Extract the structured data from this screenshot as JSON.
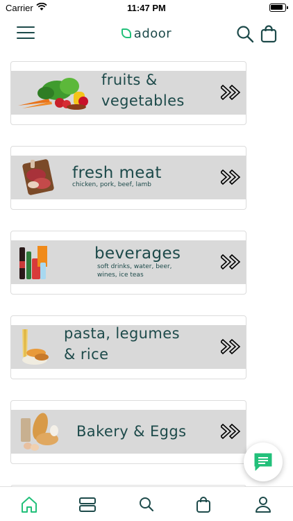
{
  "status_bar": {
    "carrier": "Carrier",
    "time": "11:47 PM"
  },
  "header": {
    "logo_text": "adoor",
    "brand_color": "#1d4a4a",
    "accent_color": "#22c07a"
  },
  "categories": [
    {
      "title_line1": "fruits &",
      "title_line2": "vegetables",
      "subtitle_line1": "",
      "subtitle_line2": "",
      "image": "vegetables-image"
    },
    {
      "title_line1": "fresh meat",
      "title_line2": "",
      "subtitle_line1": "chicken, pork, beef, lamb",
      "subtitle_line2": "",
      "image": "meat-image"
    },
    {
      "title_line1": "beverages",
      "title_line2": "",
      "subtitle_line1": "soft drinks, water, beer,",
      "subtitle_line2": "wines, ice teas",
      "image": "beverages-image"
    },
    {
      "title_line1": "pasta, legumes",
      "title_line2": "& rice",
      "subtitle_line1": "",
      "subtitle_line2": "",
      "image": "pasta-image"
    },
    {
      "title_line1": "Bakery & Eggs",
      "title_line2": "",
      "subtitle_line1": "",
      "subtitle_line2": "",
      "image": "bakery-image"
    }
  ],
  "tab_bar": {
    "tabs": [
      {
        "icon": "home-icon",
        "active": true
      },
      {
        "icon": "categories-icon",
        "active": false
      },
      {
        "icon": "search-icon",
        "active": false
      },
      {
        "icon": "cart-icon",
        "active": false
      },
      {
        "icon": "profile-icon",
        "active": false
      }
    ],
    "active_color": "#22c07a",
    "inactive_color": "#1d4a4a"
  }
}
